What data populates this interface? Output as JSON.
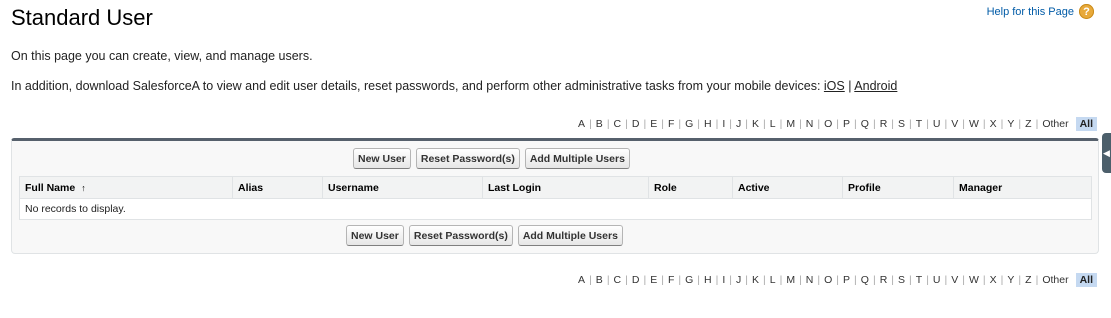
{
  "page": {
    "title": "Standard User",
    "help_label": "Help for this Page",
    "help_icon": "?",
    "description_1": "On this page you can create, view, and manage users.",
    "description_2": "In addition, download SalesforceA to view and edit user details, reset passwords, and perform other administrative tasks from your mobile devices: ",
    "ios_label": "iOS",
    "link_separator": "|",
    "android_label": "Android"
  },
  "alphabet": {
    "letters": [
      "A",
      "B",
      "C",
      "D",
      "E",
      "F",
      "G",
      "H",
      "I",
      "J",
      "K",
      "L",
      "M",
      "N",
      "O",
      "P",
      "Q",
      "R",
      "S",
      "T",
      "U",
      "V",
      "W",
      "X",
      "Y",
      "Z",
      "Other"
    ],
    "selected": "All"
  },
  "buttons": {
    "new_user": "New User",
    "reset_password": "Reset Password(s)",
    "add_multiple": "Add Multiple Users"
  },
  "table": {
    "columns": [
      "Full Name",
      "Alias",
      "Username",
      "Last Login",
      "Role",
      "Active",
      "Profile",
      "Manager"
    ],
    "sort_indicator": "↑",
    "empty_message": "No records to display."
  },
  "colors": {
    "link": "#015ba7",
    "selected_letter_bg": "#c5d9f1",
    "panel_top_border": "#56606c",
    "help_icon_bg": "#e8a93a"
  }
}
